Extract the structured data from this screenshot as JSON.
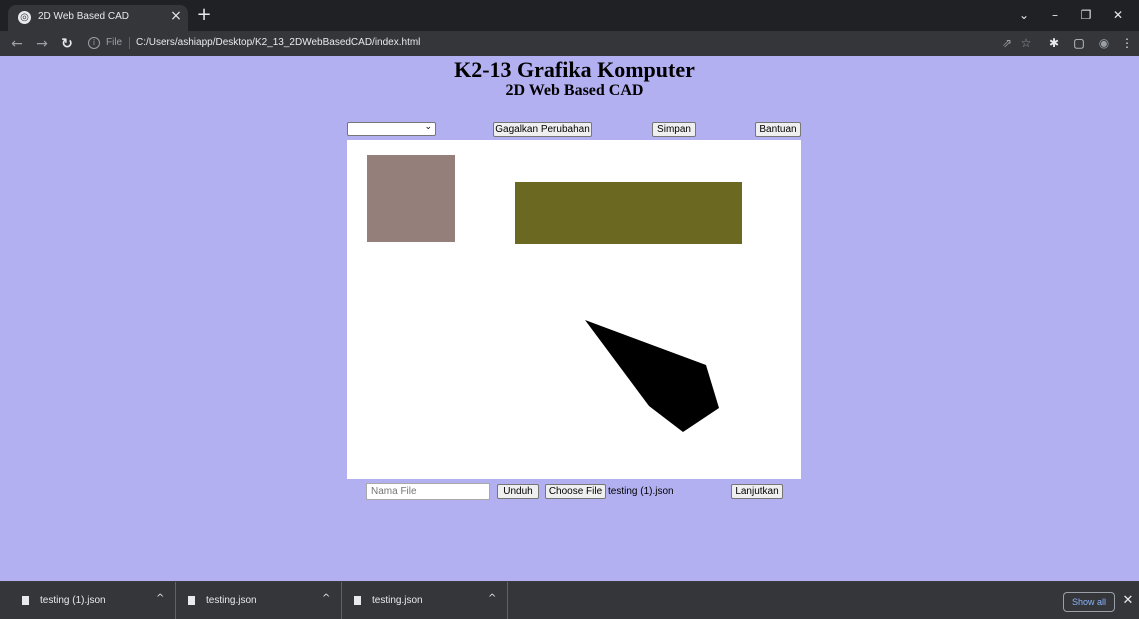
{
  "browser": {
    "tab_title": "2D Web Based CAD",
    "tab_close": "×",
    "new_tab": "+",
    "omnibox_scheme": "File",
    "url": "C:/Users/ashiapp/Desktop/K2_13_2DWebBasedCAD/index.html",
    "icons": {
      "back": "←",
      "forward": "→",
      "reload": "↻",
      "info": "i",
      "share": "⇗",
      "star": "☆",
      "extensions": "✱",
      "sidepanel": "▢",
      "profile": "◉",
      "menu": "⋮",
      "chevron": "⌄",
      "minimize": "–",
      "restore": "❐",
      "close": "✕"
    }
  },
  "page": {
    "title": "K2-13 Grafika Komputer",
    "subtitle": "2D Web Based CAD",
    "controls": {
      "shape_select_value": "",
      "select_arrow": "⌄",
      "undo_label": "Gagalkan Perubahan",
      "save_label": "Simpan",
      "help_label": "Bantuan"
    },
    "canvas": {
      "background": "#ffffff",
      "shapes": [
        {
          "type": "square",
          "color": "#947f7b"
        },
        {
          "type": "rectangle",
          "color": "#6b6822"
        },
        {
          "type": "polygon",
          "color": "#000000"
        }
      ]
    },
    "file_controls": {
      "filename_placeholder": "Nama File",
      "download_label": "Unduh",
      "choose_file_label": "Choose File",
      "chosen_file": "testing (1).json",
      "continue_label": "Lanjutkan"
    }
  },
  "downloads": {
    "items": [
      {
        "name": "testing (1).json"
      },
      {
        "name": "testing.json"
      },
      {
        "name": "testing.json"
      }
    ],
    "caret": "^",
    "show_all_label": "Show all",
    "close": "✕"
  },
  "colors": {
    "page_background": "#b3b0f1",
    "chrome_dark": "#202124",
    "chrome_toolbar": "#35363a",
    "link_blue": "#8ab4f8"
  }
}
